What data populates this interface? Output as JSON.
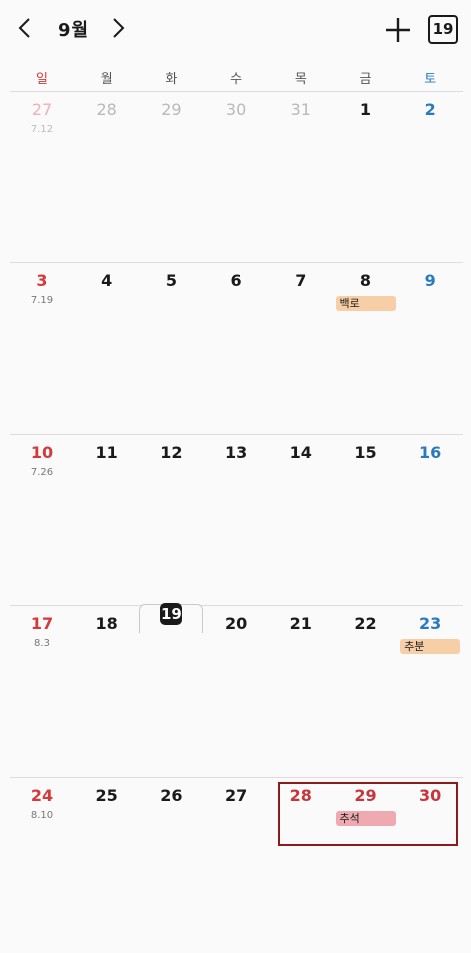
{
  "header": {
    "month_title": "9월",
    "today_label": "19"
  },
  "weekdays": [
    "일",
    "월",
    "화",
    "수",
    "목",
    "금",
    "토"
  ],
  "weeks": [
    {
      "days": [
        {
          "num": "27",
          "lunar": "7.12",
          "dim": true
        },
        {
          "num": "28",
          "dim": true
        },
        {
          "num": "29",
          "dim": true
        },
        {
          "num": "30",
          "dim": true
        },
        {
          "num": "31",
          "dim": true
        },
        {
          "num": "1"
        },
        {
          "num": "2"
        }
      ]
    },
    {
      "days": [
        {
          "num": "3",
          "lunar": "7.19"
        },
        {
          "num": "4"
        },
        {
          "num": "5"
        },
        {
          "num": "6"
        },
        {
          "num": "7"
        },
        {
          "num": "8",
          "event": "백로",
          "event_color": "#f6cfa6"
        },
        {
          "num": "9"
        }
      ]
    },
    {
      "days": [
        {
          "num": "10",
          "lunar": "7.26"
        },
        {
          "num": "11"
        },
        {
          "num": "12"
        },
        {
          "num": "13"
        },
        {
          "num": "14"
        },
        {
          "num": "15"
        },
        {
          "num": "16"
        }
      ]
    },
    {
      "days": [
        {
          "num": "17",
          "lunar": "8.3"
        },
        {
          "num": "18"
        },
        {
          "num": "19",
          "today": true
        },
        {
          "num": "20"
        },
        {
          "num": "21"
        },
        {
          "num": "22"
        },
        {
          "num": "23",
          "event": "추분",
          "event_color": "#f6cfa6"
        }
      ]
    },
    {
      "days": [
        {
          "num": "24",
          "lunar": "8.10"
        },
        {
          "num": "25"
        },
        {
          "num": "26"
        },
        {
          "num": "27"
        },
        {
          "num": "28",
          "holiday": true
        },
        {
          "num": "29",
          "holiday": true,
          "event": "추석",
          "event_color": "#efa9b0"
        },
        {
          "num": "30",
          "holiday": true
        }
      ]
    }
  ],
  "colors": {
    "sunday": "#d33a3a",
    "saturday": "#2a7bbd",
    "holiday": "#c7363c",
    "highlight_border": "#8b1c1c"
  },
  "icons": {
    "prev": "chevron-left-icon",
    "next": "chevron-right-icon",
    "add": "plus-icon"
  }
}
